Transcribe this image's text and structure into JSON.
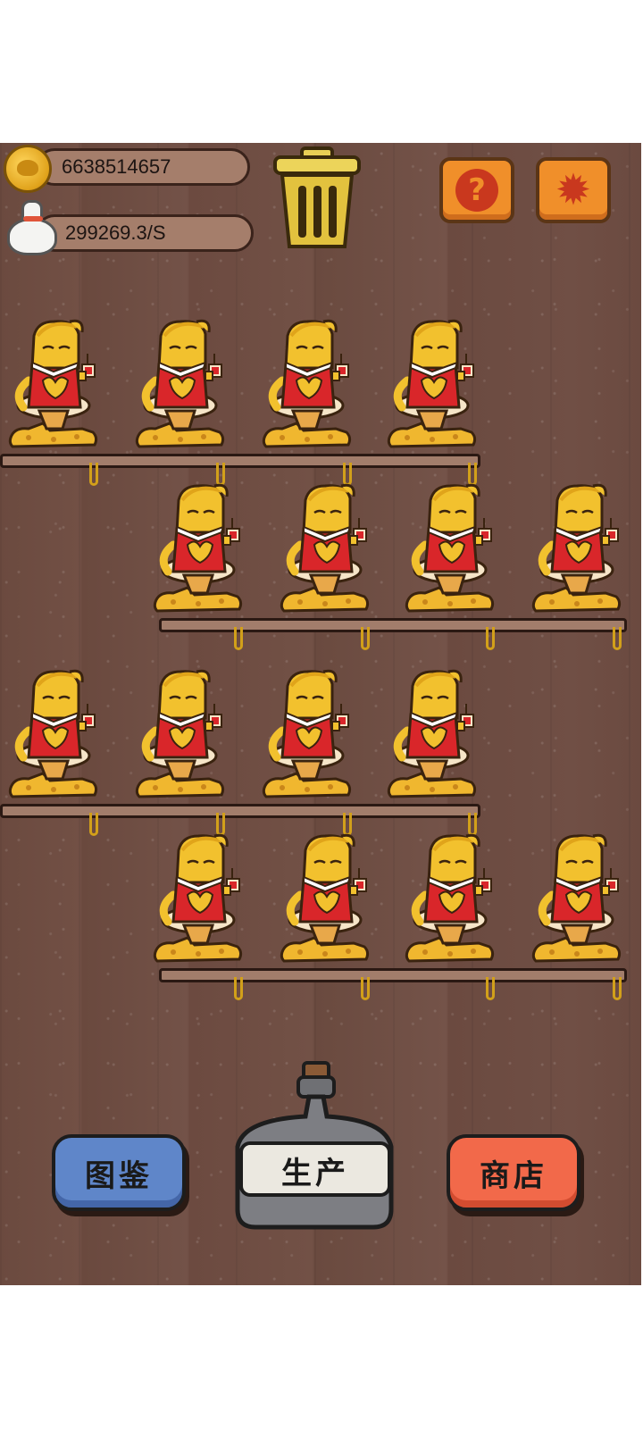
{
  "stats": {
    "coins": "6638514657",
    "rate": "299269.3/S"
  },
  "icons": {
    "coin": "coin-icon",
    "money_bag": "money-bag-icon",
    "trash": "trash-can-icon",
    "help": "question-mark-icon",
    "settings": "gear-icon"
  },
  "buttons": {
    "guide": "图鉴",
    "produce": "生产",
    "shop": "商店"
  },
  "shelves": [
    {
      "row": 1,
      "cats": 4
    },
    {
      "row": 2,
      "cats": 4
    },
    {
      "row": 3,
      "cats": 4
    },
    {
      "row": 4,
      "cats": 4
    }
  ],
  "colors": {
    "wood": "#6b4a3f",
    "guide_button": "#5f86c9",
    "shop_button": "#f2694a",
    "top_button": "#f08f2a",
    "cat_dress": "#d9262a",
    "cat_fur": "#f2c12e"
  }
}
